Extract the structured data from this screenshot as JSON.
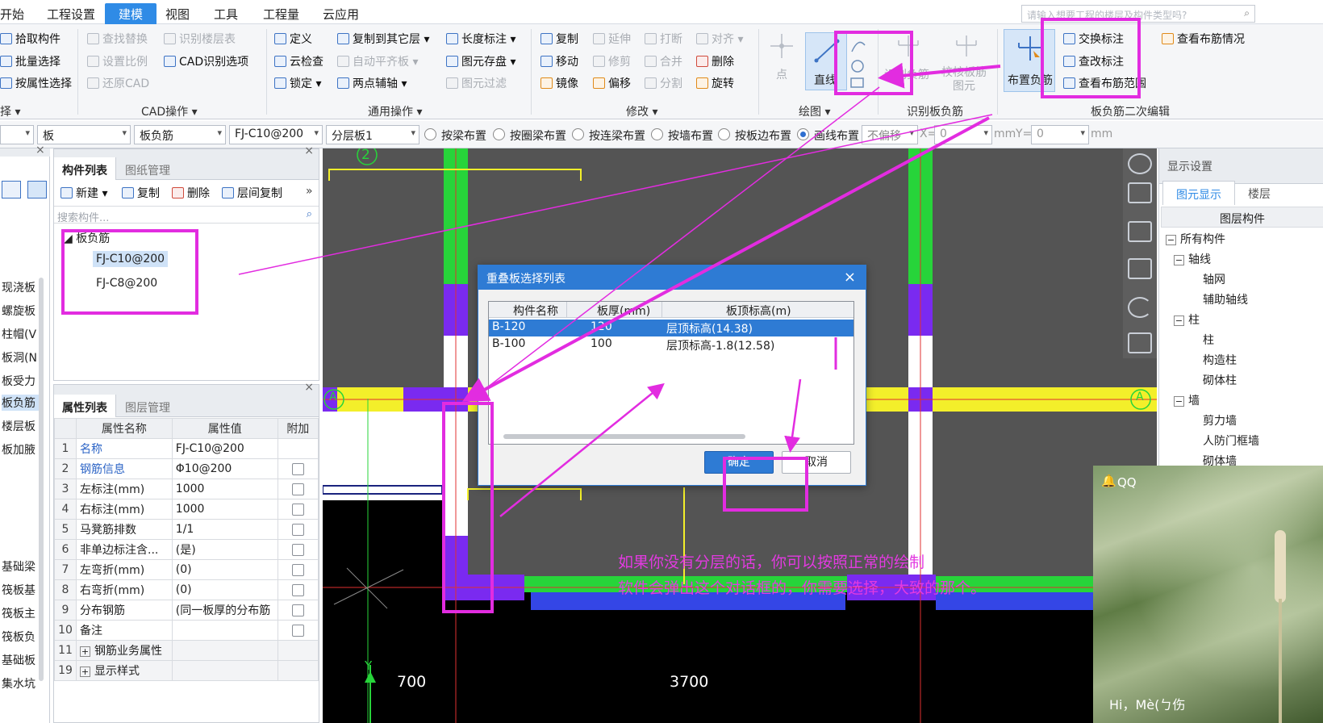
{
  "menu": {
    "items": [
      "开始",
      "工程设置",
      "建模",
      "视图",
      "工具",
      "工程量",
      "云应用"
    ],
    "active": "建模",
    "search_placeholder": "请输入想要工程的楼层及构件类型吗?"
  },
  "ribbon": {
    "select": {
      "items": [
        "拾取构件",
        "批量选择",
        "按属性选择"
      ],
      "group": "择"
    },
    "cad": {
      "items": [
        "查找替换",
        "识别楼层表",
        "设置比例",
        "CAD识别选项",
        "还原CAD"
      ],
      "group": "CAD操作"
    },
    "general": {
      "items": [
        "定义",
        "复制到其它层",
        "长度标注",
        "云检查",
        "自动平齐板",
        "图元存盘",
        "锁定",
        "两点辅轴",
        "图元过滤"
      ],
      "group": "通用操作"
    },
    "modify": {
      "items": [
        "复制",
        "延伸",
        "打断",
        "对齐",
        "移动",
        "修剪",
        "合并",
        "删除",
        "镜像",
        "偏移",
        "分割",
        "旋转"
      ],
      "group": "修改"
    },
    "draw": {
      "items": [
        "点",
        "直线"
      ],
      "group": "绘图"
    },
    "recognize": {
      "items": [
        "识别负筋",
        "校核板筋图元"
      ],
      "group": "识别板负筋"
    },
    "second": {
      "items": [
        "布置负筋",
        "交换标注",
        "查看布筋情况",
        "查改标注",
        "查看布筋范围"
      ],
      "group": "板负筋二次编辑"
    }
  },
  "options": {
    "combo1": "板",
    "combo2": "板负筋",
    "combo3": "FJ-C10@200",
    "combo4": "分层板1",
    "radios": [
      "按梁布置",
      "按圈梁布置",
      "按连梁布置",
      "按墙布置",
      "按板边布置",
      "画线布置"
    ],
    "selected_radio": "画线布置",
    "mode": "不偏移",
    "x_label": "X=",
    "x_value": "0",
    "unit1": "mm",
    "y_label": "Y=",
    "y_value": "0",
    "unit2": "mm"
  },
  "sidebar": {
    "items": [
      "现浇板",
      "螺旋板",
      "柱帽(V",
      "板洞(N",
      "板受力",
      "板负筋",
      "楼层板",
      "板加腋",
      "基础梁",
      "筏板基",
      "筏板主",
      "筏板负",
      "基础板",
      "集水坑"
    ],
    "active": "板负筋"
  },
  "component_panel": {
    "tabs": [
      "构件列表",
      "图纸管理"
    ],
    "toolbar": [
      "新建",
      "复制",
      "删除",
      "层间复制"
    ],
    "search_placeholder": "搜索构件...",
    "tree_root": "板负筋",
    "items": [
      "FJ-C10@200",
      "FJ-C8@200"
    ],
    "selected": "FJ-C10@200"
  },
  "property_panel": {
    "tabs": [
      "属性列表",
      "图层管理"
    ],
    "headers": [
      "属性名称",
      "属性值",
      "附加"
    ],
    "rows": [
      {
        "idx": "1",
        "name": "名称",
        "value": "FJ-C10@200",
        "check": false,
        "link": true
      },
      {
        "idx": "2",
        "name": "钢筋信息",
        "value": "Φ10@200",
        "check": true,
        "link": true
      },
      {
        "idx": "3",
        "name": "左标注(mm)",
        "value": "1000",
        "check": true,
        "link": false
      },
      {
        "idx": "4",
        "name": "右标注(mm)",
        "value": "1000",
        "check": true,
        "link": false
      },
      {
        "idx": "5",
        "name": "马凳筋排数",
        "value": "1/1",
        "check": true,
        "link": false
      },
      {
        "idx": "6",
        "name": "非单边标注含...",
        "value": "(是)",
        "check": true,
        "link": false
      },
      {
        "idx": "7",
        "name": "左弯折(mm)",
        "value": "(0)",
        "check": true,
        "link": false
      },
      {
        "idx": "8",
        "name": "右弯折(mm)",
        "value": "(0)",
        "check": true,
        "link": false
      },
      {
        "idx": "9",
        "name": "分布钢筋",
        "value": "(同一板厚的分布筋",
        "check": true,
        "link": false
      },
      {
        "idx": "10",
        "name": "备注",
        "value": "",
        "check": true,
        "link": false
      },
      {
        "idx": "11",
        "name": "钢筋业务属性",
        "value": "",
        "check": false,
        "link": false,
        "expand": true
      },
      {
        "idx": "19",
        "name": "显示样式",
        "value": "",
        "check": false,
        "link": false,
        "expand": true
      }
    ]
  },
  "canvas": {
    "axis_top": "2",
    "axis_left": "A",
    "axis_right": "A",
    "dim1": "700",
    "dim2": "3700",
    "y_axis": "Y"
  },
  "display_panel": {
    "title": "显示设置",
    "tabs": [
      "图元显示",
      "楼层"
    ],
    "header": "图层构件",
    "tree": [
      {
        "label": "所有构件",
        "level": 0,
        "pm": "−"
      },
      {
        "label": "轴线",
        "level": 1,
        "pm": "−"
      },
      {
        "label": "轴网",
        "level": 2
      },
      {
        "label": "辅助轴线",
        "level": 2
      },
      {
        "label": "柱",
        "level": 1,
        "pm": "−"
      },
      {
        "label": "柱",
        "level": 2
      },
      {
        "label": "构造柱",
        "level": 2
      },
      {
        "label": "砌体柱",
        "level": 2
      },
      {
        "label": "墙",
        "level": 1,
        "pm": "−"
      },
      {
        "label": "剪力墙",
        "level": 2
      },
      {
        "label": "人防门框墙",
        "level": 2
      },
      {
        "label": "砌体墙",
        "level": 2
      }
    ]
  },
  "dialog": {
    "title": "重叠板选择列表",
    "headers": [
      "构件名称",
      "板厚(mm)",
      "板顶标高(m)"
    ],
    "rows": [
      {
        "name": "B-120",
        "thick": "120",
        "elev": "层顶标高(14.38)"
      },
      {
        "name": "B-100",
        "thick": "100",
        "elev": "层顶标高-1.8(12.58)"
      }
    ],
    "ok": "确定",
    "cancel": "取消"
  },
  "annotation": {
    "line1": "如果你没有分层的话，你可以按照正常的绘制",
    "line2": "软件会弹出这个对话框的，你需要选择，大致的那个。"
  },
  "qq": {
    "brand": "QQ",
    "greeting": "Hi，Mè(ㄅ伤"
  },
  "colors": {
    "accent": "#2f8be6",
    "highlight": "#e22ce0",
    "wall_green": "#27d43a",
    "beam_yellow": "#f3ef2a",
    "slab_purple": "#7a2af0",
    "beam_blue": "#3446e6"
  }
}
